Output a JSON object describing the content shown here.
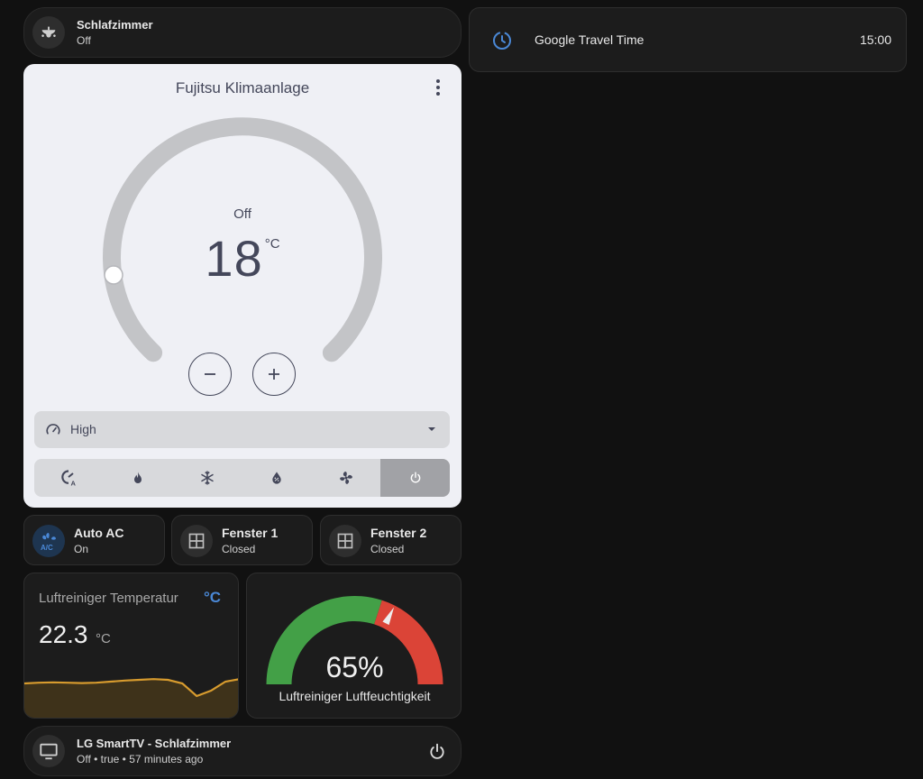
{
  "bedroom": {
    "title": "Schlafzimmer",
    "state": "Off"
  },
  "travel": {
    "title": "Google Travel Time",
    "value": "15:00"
  },
  "thermostat": {
    "title": "Fujitsu Klimaanlage",
    "state": "Off",
    "temperature": "18",
    "unit": "°C",
    "fan_mode": "High",
    "modes": [
      "heat_cool",
      "heat",
      "cool",
      "dry",
      "fan_only",
      "off"
    ],
    "active_mode": "off"
  },
  "tiles": [
    {
      "title": "Auto AC",
      "state": "On",
      "icon": "air-conditioner-icon"
    },
    {
      "title": "Fenster 1",
      "state": "Closed",
      "icon": "window-icon"
    },
    {
      "title": "Fenster 2",
      "state": "Closed",
      "icon": "window-icon"
    }
  ],
  "sensor": {
    "title": "Luftreiniger Temperatur",
    "value": "22.3",
    "unit": "°C",
    "unit_icon": "°C",
    "history": [
      0.0,
      0.02,
      0.03,
      0.02,
      0.01,
      0.02,
      0.05,
      0.08,
      0.1,
      0.12,
      0.1,
      0.0,
      -0.35,
      -0.2,
      0.05,
      0.12
    ]
  },
  "gauge": {
    "value": 65,
    "display": "65%",
    "label": "Luftreiniger Luftfeuchtigkeit",
    "severity_green_to": 60,
    "colors": {
      "green": "#43a047",
      "red": "#db4437"
    }
  },
  "tv": {
    "title": "LG SmartTV - Schlafzimmer",
    "state": "Off • true • 57 minutes ago"
  }
}
